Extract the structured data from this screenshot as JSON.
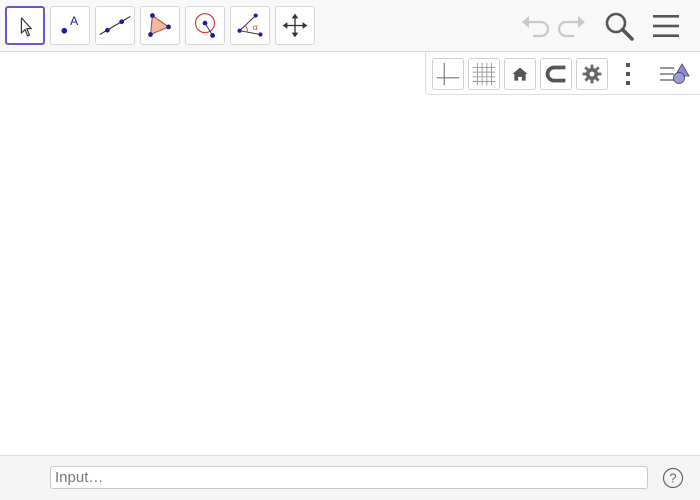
{
  "toolbar": {
    "tools": [
      {
        "name": "move-tool",
        "icon": "arrow-pointer-icon"
      },
      {
        "name": "point-tool",
        "icon": "point-a-icon"
      },
      {
        "name": "line-tool",
        "icon": "line-through-points-icon"
      },
      {
        "name": "polygon-tool",
        "icon": "triangle-polygon-icon"
      },
      {
        "name": "circle-tool",
        "icon": "circle-center-point-icon"
      },
      {
        "name": "angle-tool",
        "icon": "angle-alpha-icon"
      },
      {
        "name": "move-graphics-tool",
        "icon": "four-way-arrows-icon"
      }
    ],
    "undo_icon": "undo-icon",
    "redo_icon": "redo-icon",
    "search_icon": "search-icon",
    "menu_icon": "hamburger-menu-icon",
    "point_label": "A",
    "angle_label": "α"
  },
  "style_bar": {
    "items": [
      "axes-icon",
      "grid-icon",
      "home-icon",
      "magnet-icon",
      "gear-icon",
      "more-vertical-icon",
      "toggle-style-bar-icon"
    ]
  },
  "input_bar": {
    "placeholder": "Input…",
    "help_label": "?"
  },
  "colors": {
    "accent": "#6557d2",
    "point_blue": "#1a1aad",
    "polygon_fill": "#f2b8a0",
    "circle_red": "#d33",
    "disabled": "#c8c8c8"
  }
}
